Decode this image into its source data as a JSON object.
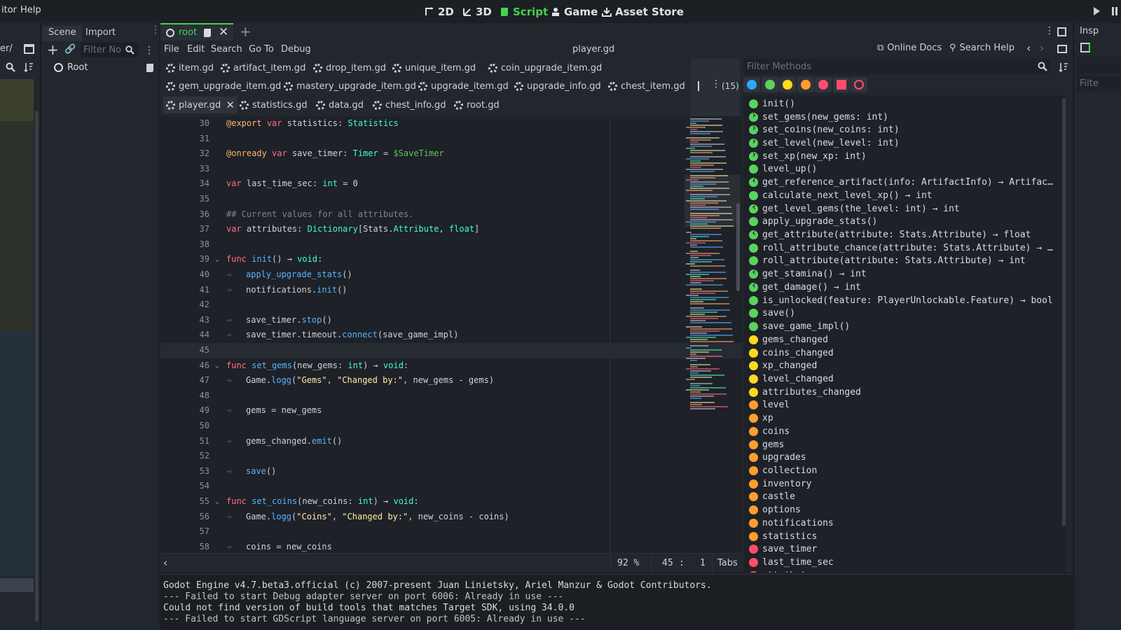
{
  "topbar": {
    "menus": [
      "itor",
      "Help"
    ],
    "modes": [
      {
        "label": "2D",
        "icon": "2d-icon"
      },
      {
        "label": "3D",
        "icon": "3d-icon"
      },
      {
        "label": "Script",
        "icon": "script-icon",
        "active": true
      },
      {
        "label": "Game",
        "icon": "game-icon"
      },
      {
        "label": "Asset Store",
        "icon": "asset-store-icon"
      }
    ],
    "accent": "#45d34b"
  },
  "leftdock": {
    "path": "er/"
  },
  "scenedock": {
    "tabs": [
      "Scene",
      "Import"
    ],
    "filter_placeholder": "Filter No",
    "root_node": "Root"
  },
  "editor": {
    "scene_tab": "root",
    "menus": [
      "File",
      "Edit",
      "Search",
      "Go To",
      "Debug"
    ],
    "current_file": "player.gd",
    "online_docs": "Online Docs",
    "search_help": "Search Help",
    "open_count": "(15)",
    "file_tabs": [
      [
        "item.gd",
        "artifact_item.gd",
        "drop_item.gd",
        "unique_item.gd",
        "coin_upgrade_item.gd"
      ],
      [
        "gem_upgrade_item.gd",
        "mastery_upgrade_item.gd",
        "upgrade_item.gd",
        "upgrade_info.gd",
        "chest_item.gd"
      ],
      [
        "player.gd",
        "statistics.gd",
        "data.gd",
        "chest_info.gd",
        "root.gd"
      ]
    ],
    "status": {
      "zoom": "92 %",
      "line": "45",
      "col": "1",
      "indent": "Tabs"
    }
  },
  "code_lines": [
    {
      "n": "30",
      "html": "<span class='an'>@export</span> <span class='kw'>var</span> statistics: <span class='ty'>Statistics</span>"
    },
    {
      "n": "31",
      "html": ""
    },
    {
      "n": "32",
      "html": "<span class='an'>@onready</span> <span class='kw'>var</span> save_timer: <span class='ty'>Timer</span> = <span class='nd'>$SaveTimer</span>"
    },
    {
      "n": "33",
      "html": ""
    },
    {
      "n": "34",
      "html": "<span class='kw'>var</span> last_time_sec: <span class='ty'>int</span> = 0"
    },
    {
      "n": "35",
      "html": ""
    },
    {
      "n": "36",
      "html": "<span class='cm'>## Current values for all attributes.</span>"
    },
    {
      "n": "37",
      "html": "<span class='kw'>var</span> attributes: <span class='ty'>Dictionary</span>[Stats.<span class='ty'>Attribute</span>, <span class='ty'>float</span>]"
    },
    {
      "n": "38",
      "html": ""
    },
    {
      "n": "39",
      "fold": true,
      "html": "<span class='kw'>func</span> <span class='fn'>init</span>() → <span class='ty'>void</span>:"
    },
    {
      "n": "40",
      "tab": true,
      "html": "<span class='fn'>apply_upgrade_stats</span>()"
    },
    {
      "n": "41",
      "tab": true,
      "html": "notifications.<span class='fn'>init</span>()"
    },
    {
      "n": "42",
      "html": ""
    },
    {
      "n": "43",
      "tab": true,
      "html": "save_timer.<span class='fn'>stop</span>()"
    },
    {
      "n": "44",
      "tab": true,
      "html": "save_timer.timeout.<span class='fn'>connect</span>(save_game_impl)"
    },
    {
      "n": "45",
      "current": true,
      "html": ""
    },
    {
      "n": "46",
      "fold": true,
      "html": "<span class='kw'>func</span> <span class='fn'>set_gems</span>(new_gems: <span class='ty'>int</span>) → <span class='ty'>void</span>:"
    },
    {
      "n": "47",
      "tab": true,
      "html": "Game.<span class='fn'>logg</span>(<span class='st'>\"Gems\"</span>, <span class='st'>\"Changed by:\"</span>, new_gems - gems)"
    },
    {
      "n": "48",
      "html": ""
    },
    {
      "n": "49",
      "tab": true,
      "html": "gems = new_gems"
    },
    {
      "n": "50",
      "html": ""
    },
    {
      "n": "51",
      "tab": true,
      "html": "gems_changed.<span class='fn'>emit</span>()"
    },
    {
      "n": "52",
      "html": ""
    },
    {
      "n": "53",
      "tab": true,
      "html": "<span class='fn'>save</span>()"
    },
    {
      "n": "54",
      "html": ""
    },
    {
      "n": "55",
      "fold": true,
      "html": "<span class='kw'>func</span> <span class='fn'>set_coins</span>(new_coins: <span class='ty'>int</span>) → <span class='ty'>void</span>:"
    },
    {
      "n": "56",
      "tab": true,
      "html": "Game.<span class='fn'>logg</span>(<span class='st'>\"Coins\"</span>, <span class='st'>\"Changed by:\"</span>, new_coins - coins)"
    },
    {
      "n": "57",
      "html": ""
    },
    {
      "n": "58",
      "tab": true,
      "html": "coins = new_coins"
    }
  ],
  "methods": {
    "filter_placeholder": "Filter Methods",
    "filter_colors": [
      "#2ea8ff",
      "#5bd15e",
      "#ffd91a",
      "#ff9d2e",
      "#ff4d6b",
      "#ff4d6b",
      "#ff4d6b"
    ],
    "items": [
      {
        "label": "init()",
        "color": "#5bd15e",
        "kind": ""
      },
      {
        "label": "set_gems(new_gems: int)",
        "color": "#5bd15e",
        "kind": "arrow"
      },
      {
        "label": "set_coins(new_coins: int)",
        "color": "#5bd15e",
        "kind": "arrow"
      },
      {
        "label": "set_level(new_level: int)",
        "color": "#5bd15e",
        "kind": "arrow"
      },
      {
        "label": "set_xp(new_xp: int)",
        "color": "#5bd15e",
        "kind": "arrow"
      },
      {
        "label": "level_up()",
        "color": "#5bd15e",
        "kind": ""
      },
      {
        "label": "get_reference_artifact(info: ArtifactInfo) → Artifac…",
        "color": "#5bd15e",
        "kind": "arrowl"
      },
      {
        "label": "calculate_next_level_xp() → int",
        "color": "#5bd15e",
        "kind": ""
      },
      {
        "label": "get_level_gems(the_level: int) → int",
        "color": "#5bd15e",
        "kind": "arrowl"
      },
      {
        "label": "apply_upgrade_stats()",
        "color": "#5bd15e",
        "kind": ""
      },
      {
        "label": "get_attribute(attribute: Stats.Attribute) → float",
        "color": "#5bd15e",
        "kind": "arrowl"
      },
      {
        "label": "roll_attribute_chance(attribute: Stats.Attribute) → …",
        "color": "#5bd15e",
        "kind": ""
      },
      {
        "label": "roll_attribute(attribute: Stats.Attribute) → int",
        "color": "#5bd15e",
        "kind": ""
      },
      {
        "label": "get_stamina() → int",
        "color": "#5bd15e",
        "kind": "arrowl"
      },
      {
        "label": "get_damage() → int",
        "color": "#5bd15e",
        "kind": "arrowl"
      },
      {
        "label": "is_unlocked(feature: PlayerUnlockable.Feature) → bool",
        "color": "#5bd15e",
        "kind": ""
      },
      {
        "label": "save()",
        "color": "#5bd15e",
        "kind": ""
      },
      {
        "label": "save_game_impl()",
        "color": "#5bd15e",
        "kind": ""
      },
      {
        "label": "gems_changed",
        "color": "#ffd91a",
        "kind": ""
      },
      {
        "label": "coins_changed",
        "color": "#ffd91a",
        "kind": ""
      },
      {
        "label": "xp_changed",
        "color": "#ffd91a",
        "kind": ""
      },
      {
        "label": "level_changed",
        "color": "#ffd91a",
        "kind": ""
      },
      {
        "label": "attributes_changed",
        "color": "#ffd91a",
        "kind": ""
      },
      {
        "label": "level",
        "color": "#ff9d2e",
        "kind": ""
      },
      {
        "label": "xp",
        "color": "#ff9d2e",
        "kind": ""
      },
      {
        "label": "coins",
        "color": "#ff9d2e",
        "kind": ""
      },
      {
        "label": "gems",
        "color": "#ff9d2e",
        "kind": ""
      },
      {
        "label": "upgrades",
        "color": "#ff9d2e",
        "kind": ""
      },
      {
        "label": "collection",
        "color": "#ff9d2e",
        "kind": ""
      },
      {
        "label": "inventory",
        "color": "#ff9d2e",
        "kind": ""
      },
      {
        "label": "castle",
        "color": "#ff9d2e",
        "kind": ""
      },
      {
        "label": "options",
        "color": "#ff9d2e",
        "kind": ""
      },
      {
        "label": "notifications",
        "color": "#ff9d2e",
        "kind": ""
      },
      {
        "label": "statistics",
        "color": "#ff9d2e",
        "kind": ""
      },
      {
        "label": "save_timer",
        "color": "#ff4d6b",
        "kind": ""
      },
      {
        "label": "last_time_sec",
        "color": "#ff4d6b",
        "kind": ""
      },
      {
        "label": "attributes",
        "color": "#ff4d6b",
        "kind": ""
      }
    ]
  },
  "output_lines": [
    "Godot Engine v4.7.beta3.official (c) 2007-present Juan Linietsky, Ariel Manzur & Godot Contributors.",
    "--- Failed to start Debug adapter server on port 6006: Already in use ---",
    "Could not find version of build tools that matches Target SDK, using 34.0.0",
    "--- Failed to start GDScript language server on port 6005: Already in use ---"
  ],
  "inspector": {
    "title": "Insp",
    "filter": "Filte"
  }
}
